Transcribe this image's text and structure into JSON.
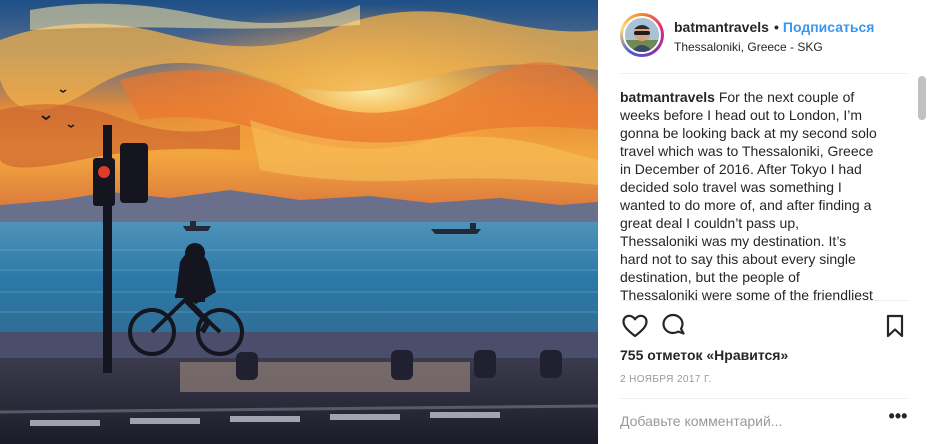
{
  "post": {
    "image": {
      "icon": "sunset-photo",
      "alt": ""
    },
    "header": {
      "username": "batmantravels",
      "follow_label": "Подписаться",
      "separator": "•",
      "location": "Thessaloniki, Greece - SKG"
    },
    "caption": {
      "username": "batmantravels",
      "text": "For the next couple of weeks before I head out to London, I’m gonna be looking back at my second solo travel which was to Thessaloniki, Greece in December of 2016. After Tokyo I had decided solo travel was something I wanted to do more of, and after finding a great deal I couldn’t pass up, Thessaloniki was my destination. It’s hard not to say this about every single destination, but the people of Thessaloniki were some of the friendliest I’ve met. The city itself was"
    },
    "actions": {
      "like_icon": "heart-icon",
      "comment_icon": "comment-icon",
      "save_icon": "bookmark-icon"
    },
    "likes": "755 отметок «Нравится»",
    "date": "2 НОЯБРЯ 2017 Г.",
    "comment": {
      "placeholder": "Добавьте комментарий...",
      "more_label": "•••"
    },
    "colors": {
      "link": "#3897f0",
      "text": "#262626",
      "muted": "#999999",
      "divider": "#efefef"
    }
  }
}
